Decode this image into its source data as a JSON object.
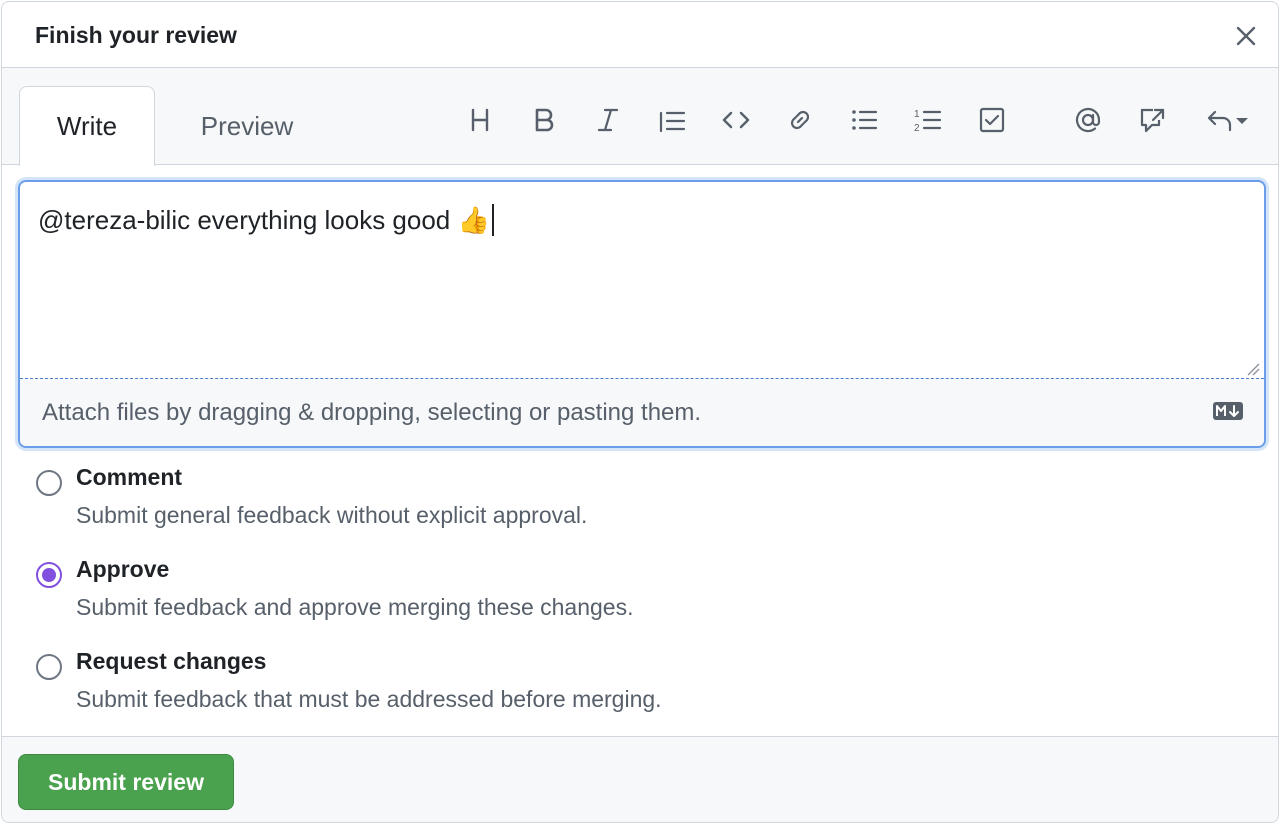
{
  "dialog": {
    "title": "Finish your review",
    "close_icon": "close-icon"
  },
  "tabs": [
    {
      "label": "Write",
      "active": true
    },
    {
      "label": "Preview",
      "active": false
    }
  ],
  "toolbar": {
    "icons": [
      "heading-icon",
      "bold-icon",
      "italic-icon",
      "quote-icon",
      "code-icon",
      "link-icon",
      "unordered-list-icon",
      "ordered-list-icon",
      "task-list-icon",
      "mention-icon",
      "cross-reference-icon",
      "reply-icon"
    ]
  },
  "editor": {
    "value": "@tereza-bilic everything looks good 👍",
    "attach_text": "Attach files by dragging & dropping, selecting or pasting them.",
    "markdown_icon": "markdown-icon"
  },
  "options": [
    {
      "title": "Comment",
      "description": "Submit general feedback without explicit approval.",
      "checked": false
    },
    {
      "title": "Approve",
      "description": "Submit feedback and approve merging these changes.",
      "checked": true
    },
    {
      "title": "Request changes",
      "description": "Submit feedback that must be addressed before merging.",
      "checked": false
    }
  ],
  "footer": {
    "submit_label": "Submit review"
  },
  "colors": {
    "accent_purple": "#8250df",
    "submit_green": "#4aa14e",
    "focus_blue": "#6a9ee8"
  }
}
